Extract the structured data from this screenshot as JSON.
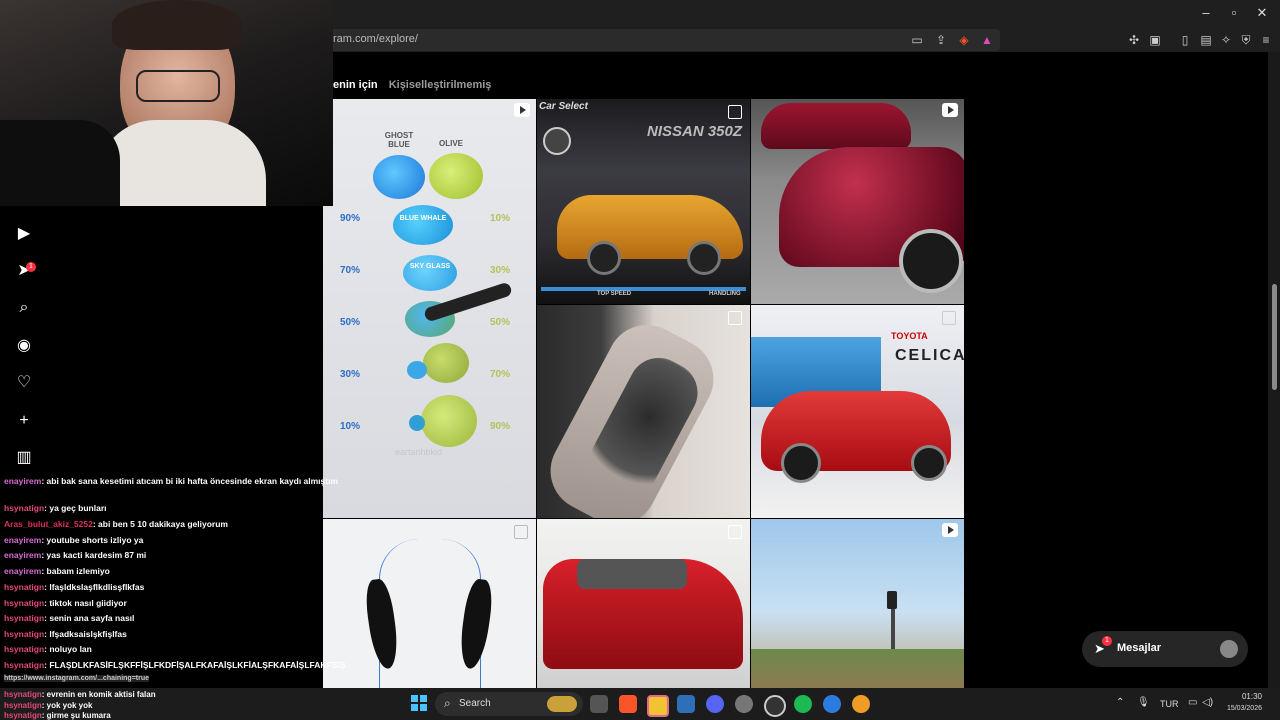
{
  "browser": {
    "url": "ram.com/explore/",
    "window_controls": {
      "minimize": "–",
      "maximize": "▫",
      "close": "✕"
    }
  },
  "page": {
    "tabs": [
      {
        "label": "enin için"
      },
      {
        "label": "Kişiselleştirilmemiş"
      }
    ],
    "tile1": {
      "col_left_header": "GHOST BLUE",
      "col_right_header": "OLIVE",
      "blob_labels": [
        "BLUE WHALE",
        "SKY GLASS"
      ],
      "left_pcts": [
        "90%",
        "70%",
        "50%",
        "30%",
        "10%"
      ],
      "right_pcts": [
        "10%",
        "30%",
        "50%",
        "70%",
        "90%"
      ],
      "watermark": "eartanhbkid"
    },
    "tile2": {
      "header": "Car Select",
      "model": "NISSAN 350Z",
      "hud_left": "TOP SPEED",
      "hud_right": "HANDLING"
    },
    "tile5": {
      "brand": "TOYOTA",
      "model": "CELICA"
    }
  },
  "messages": {
    "label": "Mesajlar",
    "badge": "1"
  },
  "sidebar": {
    "notification_badge": "1"
  },
  "chat": {
    "lines": [
      {
        "user": "enayirem",
        "text": ": abi bak sana kesetimi atıcam bi iki hafta öncesinde ekran kaydı almıştım",
        "cls": "u-pink"
      },
      {
        "user": "hsynatign",
        "text": ": ya geç bunları",
        "cls": "u-red"
      },
      {
        "user": "Aras_bulut_akiz_5252",
        "text": ": abi ben 5 10 dakikaya geliyorum",
        "cls": "u-dark"
      },
      {
        "user": "enayirem",
        "text": ": youtube shorts izliyo ya",
        "cls": "u-pink"
      },
      {
        "user": "enayirem",
        "text": ": yas kacti kardesim 87 mi",
        "cls": "u-pink"
      },
      {
        "user": "enayirem",
        "text": ": babam izlemiyo",
        "cls": "u-pink"
      },
      {
        "user": "hsynatign",
        "text": ": lfaşldkslaşflkdlisşflkfas",
        "cls": "u-red"
      },
      {
        "user": "hsynatign",
        "text": ": tiktok nasıl giidiyor",
        "cls": "u-red"
      },
      {
        "user": "hsynatign",
        "text": ": senin ana sayfa nasıl",
        "cls": "u-red"
      },
      {
        "user": "hsynatign",
        "text": ": lfşadksaislşkfişlfas",
        "cls": "u-red"
      },
      {
        "user": "hsynatign",
        "text": ": noluyo lan",
        "cls": "u-red"
      },
      {
        "user": "hsynatign",
        "text": ": FLAŞDLKFASİFLŞKFFİŞLFKDFİŞALFKAFAİŞLKFİALŞFKAFAİŞLFAKFSİŞ",
        "cls": "u-red"
      },
      {
        "user": "hsynatign",
        "text": ": evrenin en komik aktisi falan",
        "cls": "u-red"
      },
      {
        "user": "hsynatign",
        "text": ": yok yok yok",
        "cls": "u-red"
      },
      {
        "user": "hsynatign",
        "text": ": girme şu kumara",
        "cls": "u-red"
      }
    ],
    "status_url": "https://www.instagram.com/...chaining=true"
  },
  "taskbar": {
    "search_placeholder": "Search",
    "lang": "TUR",
    "time": "01:30",
    "date": "15/03/2026"
  }
}
